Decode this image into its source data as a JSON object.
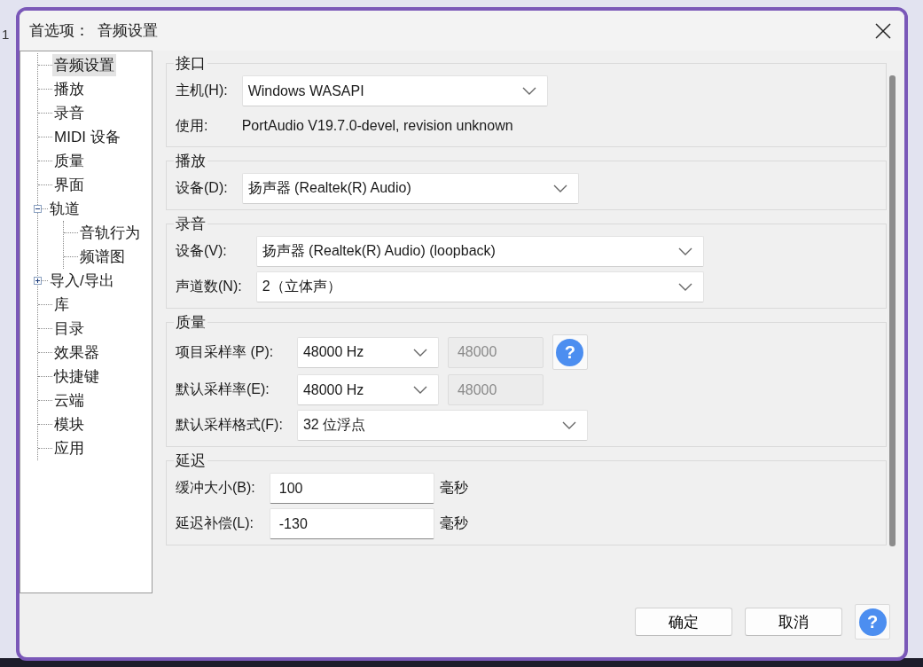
{
  "background": {
    "label": "1"
  },
  "window": {
    "title": "首选项：  音频设置"
  },
  "sidebar": {
    "items": [
      {
        "label": "音频设置",
        "selected": true
      },
      {
        "label": "播放",
        "selected": false
      },
      {
        "label": "录音",
        "selected": false
      },
      {
        "label": "MIDI 设备",
        "selected": false
      },
      {
        "label": "质量",
        "selected": false
      },
      {
        "label": "界面",
        "selected": false
      },
      {
        "label": "轨道",
        "selected": false,
        "expanded": true,
        "children": [
          {
            "label": "音轨行为",
            "selected": false
          },
          {
            "label": "频谱图",
            "selected": false
          }
        ]
      },
      {
        "label": "导入/导出",
        "selected": false,
        "expanded": false
      },
      {
        "label": "库",
        "selected": false
      },
      {
        "label": "目录",
        "selected": false
      },
      {
        "label": "效果器",
        "selected": false
      },
      {
        "label": "快捷键",
        "selected": false
      },
      {
        "label": "云端",
        "selected": false
      },
      {
        "label": "模块",
        "selected": false
      },
      {
        "label": "应用",
        "selected": false
      }
    ]
  },
  "groups": [
    {
      "title": "接口",
      "rows": [
        {
          "label": "主机(H):",
          "controls": [
            {
              "kind": "dropdown",
              "value": "Windows WASAPI"
            }
          ]
        },
        {
          "label": "使用:",
          "controls": [
            {
              "kind": "text",
              "value": "PortAudio V19.7.0-devel, revision unknown"
            }
          ]
        }
      ]
    },
    {
      "title": "播放",
      "rows": [
        {
          "label": "设备(D):",
          "controls": [
            {
              "kind": "dropdown",
              "value": "扬声器 (Realtek(R) Audio)"
            }
          ]
        }
      ]
    },
    {
      "title": "录音",
      "rows": [
        {
          "label": "设备(V):",
          "controls": [
            {
              "kind": "dropdown",
              "value": "扬声器 (Realtek(R) Audio) (loopback)"
            }
          ]
        },
        {
          "label": "声道数(N):",
          "controls": [
            {
              "kind": "dropdown",
              "value": "2（立体声）"
            }
          ]
        }
      ]
    },
    {
      "title": "质量",
      "rows": [
        {
          "label": "项目采样率 (P):",
          "controls": [
            {
              "kind": "dropdown",
              "value": "48000 Hz"
            },
            {
              "kind": "field",
              "value": "48000",
              "disabled": true
            },
            {
              "kind": "help",
              "icon": "?"
            }
          ]
        },
        {
          "label": "默认采样率(E):",
          "controls": [
            {
              "kind": "dropdown",
              "value": "48000 Hz"
            },
            {
              "kind": "field",
              "value": "48000",
              "disabled": true
            }
          ]
        },
        {
          "label": "默认采样格式(F):",
          "controls": [
            {
              "kind": "dropdown",
              "value": "32 位浮点"
            }
          ]
        }
      ]
    },
    {
      "title": "延迟",
      "rows": [
        {
          "label": "缓冲大小(B):",
          "controls": [
            {
              "kind": "field",
              "value": "100",
              "disabled": false
            },
            {
              "kind": "unit",
              "value": "毫秒"
            }
          ]
        },
        {
          "label": "延迟补偿(L):",
          "controls": [
            {
              "kind": "field",
              "value": "-130",
              "disabled": false
            },
            {
              "kind": "unit",
              "value": "毫秒"
            }
          ]
        }
      ]
    }
  ],
  "buttons": [
    {
      "kind": "text",
      "label": "确定"
    },
    {
      "kind": "text",
      "label": "取消"
    },
    {
      "kind": "help",
      "icon": "?"
    }
  ]
}
